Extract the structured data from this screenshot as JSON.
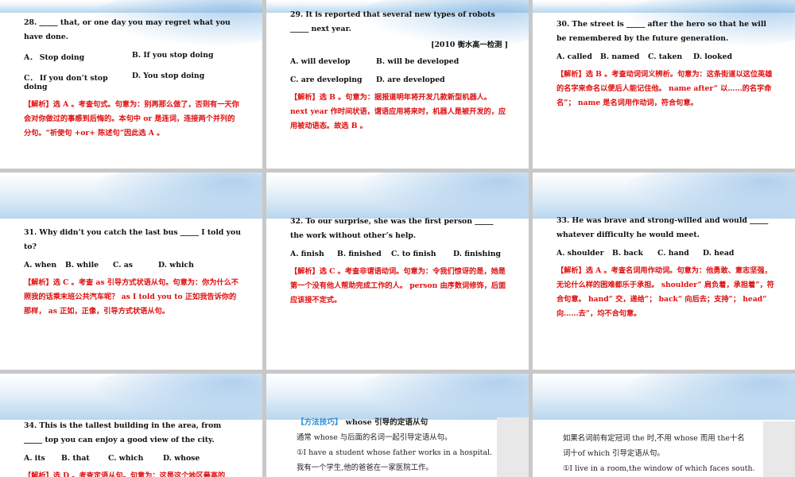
{
  "s28": {
    "question": "28. _____ that, or one day you may regret what you have done.",
    "options": [
      "A．  Stop doing",
      "B. If you stop doing",
      "C．  If you don’t stop doing",
      "D. You stop doing"
    ],
    "explanation": "【解析】选 A 。考查句式。句意为：别再那么做了，否则有一天你会对你做过的事感到后悔的。本句中 or 是连词，连接两个并列的分句。“祈使句 +or+ 陈述句”因此选 A 。"
  },
  "s29": {
    "question": "29. It is reported that several new types of robots _____ next year.",
    "source": "[2010 衡水高一检测 ]",
    "options": [
      "A. will develop",
      "B. will be developed",
      "C. are developing",
      "D. are developed"
    ],
    "explanation": "【解析】选 B 。句意为：据报道明年将开发几款新型机器人。next year 作时间状语，谓语应用将来时，机器人是被开发的，应用被动语态。故选 B 。"
  },
  "s30": {
    "question": "30. The street is _____ after the hero so that he will be remembered by the future generation.",
    "options": [
      "A. called",
      "B. named",
      "C. taken",
      "D. looked"
    ],
    "explanation": "【解析】选 B 。考查动词词义辨析。句意为：这条街道以这位英雄的名字来命名以便后人能记住他。 name after“ 以……的名字命名”； name 是名词用作动词，符合句意。"
  },
  "s31": {
    "question": "31. Why didn’t you catch the last bus _____ I told you to?",
    "options": [
      "A. when",
      "B. while",
      "C. as",
      "D. which"
    ],
    "explanation": "【解析】选 C 。考查 as 引导方式状语从句。句意为：你为什么不照我的话乘末班公共汽车呢？ as I told you to 正如我告诉你的那样， as 正如，正像，引导方式状语从句。"
  },
  "s32": {
    "question": "32. To our surprise, she was the first person _____ the work without other’s help.",
    "options": [
      "A. finish",
      "B. finished",
      "C. to finish",
      "D. finishing"
    ],
    "explanation": "【解析】选 C 。考查非谓语动词。句意为：令我们惊讶的是，她是第一个没有他人帮助完成工作的人。 person 由序数词修饰，后面应该接不定式。"
  },
  "s33": {
    "question": "33. He was brave and strong-willed and would _____ whatever difficulty he would meet.",
    "options": [
      "A. shoulder",
      "B. back",
      "C. hand",
      "D. head"
    ],
    "explanation": "【解析】选 A 。考查名词用作动词。句意为：他勇敢、意志坚强，无论什么样的困难都乐于承担。 shoulder“ 肩负着，承担着”，符合句意。 hand“ 交，递给”； back“ 向后去；支持”； head“ 向……去”，均不合句意。"
  },
  "s34": {
    "question": "34. This is the tallest building in the area, from _____ top you can enjoy a good view of the city.",
    "options": [
      "A. its",
      "B. that",
      "C. which",
      "D. whose"
    ],
    "explanation": "【解析】选 D 。考查定语从句。句意为：这是这个地区最高的"
  },
  "tip1": {
    "tag": "【方法技巧】",
    "title": "whose 引导的定语从句",
    "lines": [
      "通常 whose 与后面的名词一起引导定语从句。",
      "①I have a student whose father works in a hospital.",
      "我有一个学生,他的爸爸在一家医院工作。"
    ]
  },
  "tip2": {
    "lines": [
      "如果名词前有定冠词 the 时,不用 whose 而用 the十名",
      "词十of which 引导定语从句。",
      "①I live in a room,the window of which faces south."
    ]
  }
}
